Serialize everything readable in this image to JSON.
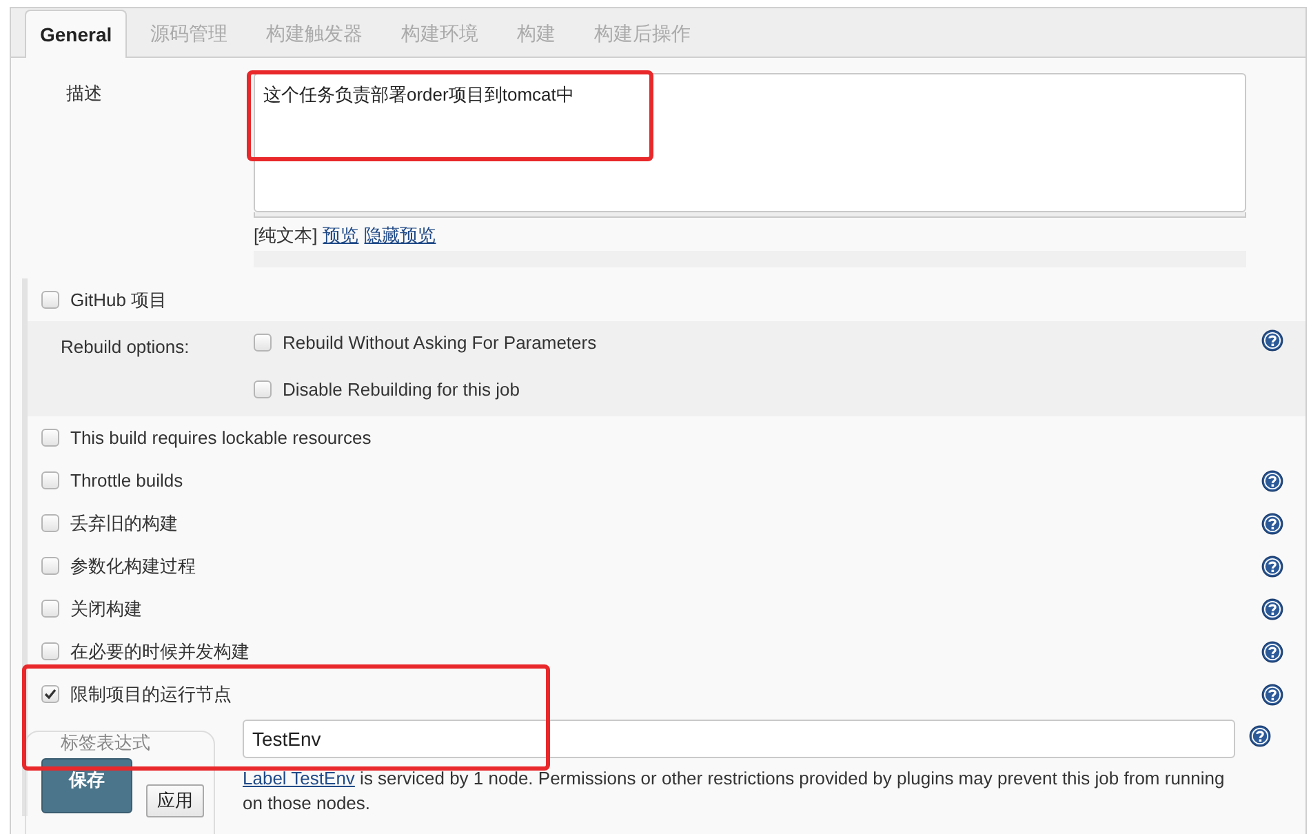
{
  "tabs": [
    {
      "label": "General",
      "selected": true
    },
    {
      "label": "源码管理",
      "selected": false
    },
    {
      "label": "构建触发器",
      "selected": false
    },
    {
      "label": "构建环境",
      "selected": false
    },
    {
      "label": "构建",
      "selected": false
    },
    {
      "label": "构建后操作",
      "selected": false
    }
  ],
  "description": {
    "label": "描述",
    "value": "这个任务负责部署order项目到tomcat中",
    "format": "[纯文本]",
    "links": [
      "预览",
      "隐藏预览"
    ]
  },
  "options": [
    {
      "kind": "checkbox",
      "label": "GitHub 项目",
      "checked": false,
      "help": false
    },
    {
      "kind": "group",
      "label": "Rebuild options:",
      "help": true,
      "children": [
        {
          "label": "Rebuild Without Asking For Parameters",
          "checked": false
        },
        {
          "label": "Disable Rebuilding for this job",
          "checked": false
        }
      ]
    },
    {
      "kind": "checkbox",
      "label": "This build requires lockable resources",
      "checked": false,
      "help": false
    },
    {
      "kind": "checkbox",
      "label": "Throttle builds",
      "checked": false,
      "help": true
    },
    {
      "kind": "checkbox",
      "label": "丢弃旧的构建",
      "checked": false,
      "help": true
    },
    {
      "kind": "checkbox",
      "label": "参数化构建过程",
      "checked": false,
      "help": true
    },
    {
      "kind": "checkbox",
      "label": "关闭构建",
      "checked": false,
      "help": true
    },
    {
      "kind": "checkbox",
      "label": "在必要的时候并发构建",
      "checked": false,
      "help": true
    },
    {
      "kind": "checkbox",
      "label": "限制项目的运行节点",
      "checked": true,
      "help": true
    }
  ],
  "label_expression": {
    "label": "标签表达式",
    "value": "TestEnv",
    "help": true,
    "note_link": "Label TestEnv",
    "note": " is serviced by 1 node. Permissions or other restrictions provided by plugins may prevent this job from running on those nodes."
  },
  "buttons": [
    {
      "label": "保存",
      "kind": "primary"
    },
    {
      "label": "应用",
      "kind": "secondary"
    }
  ]
}
